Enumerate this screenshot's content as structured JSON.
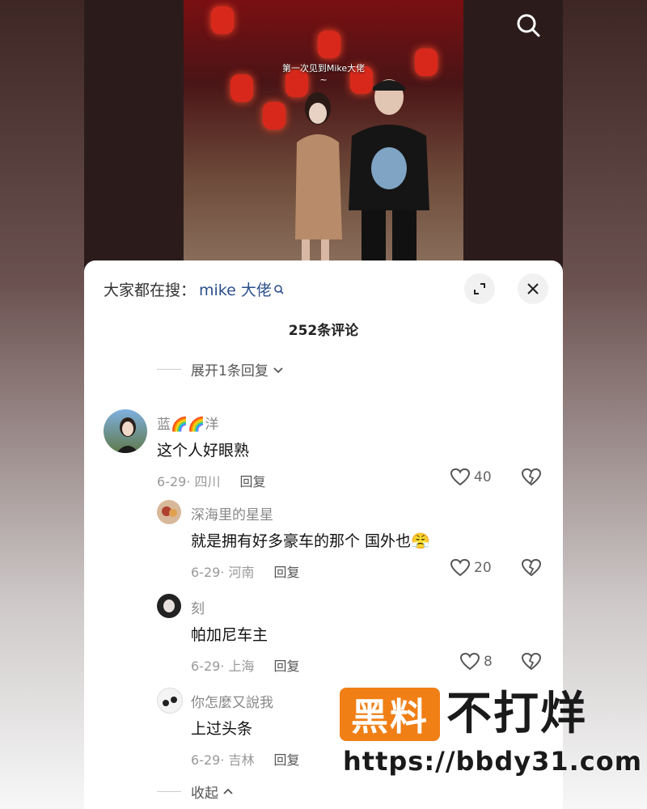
{
  "video": {
    "caption": "第一次见到Mike大佬",
    "caption_tilde": "~",
    "search_icon": "search-icon"
  },
  "sheet": {
    "hot_prefix": "大家都在搜：",
    "hot_keyword": "mike 大佬",
    "comment_count": "252条评论",
    "expand_icon": "expand-icon",
    "close_icon": "close-icon",
    "expand_replies": "展开1条回复",
    "collapse": "收起"
  },
  "comments": [
    {
      "name": "蓝🌈🌈洋",
      "text": "这个人好眼熟",
      "date": "6-29· 四川",
      "reply": "回复",
      "likes": "40"
    },
    {
      "name": "深海里的星星",
      "text": "就是拥有好多豪车的那个 国外也😤",
      "date": "6-29· 河南",
      "reply": "回复",
      "likes": "20"
    },
    {
      "name": "刻",
      "text": "帕加尼车主",
      "date": "6-29· 上海",
      "reply": "回复",
      "likes": "8"
    },
    {
      "name": "你怎麼又說我",
      "text": "上过头条",
      "date": "6-29· 吉林",
      "reply": "回复",
      "likes": ""
    }
  ],
  "watermark": {
    "badge": "黑料",
    "text": "不打烊",
    "url": "https://bbdy31.com"
  },
  "colors": {
    "accent_keyword": "#2b4f8c",
    "watermark_orange": "#f07f16"
  }
}
